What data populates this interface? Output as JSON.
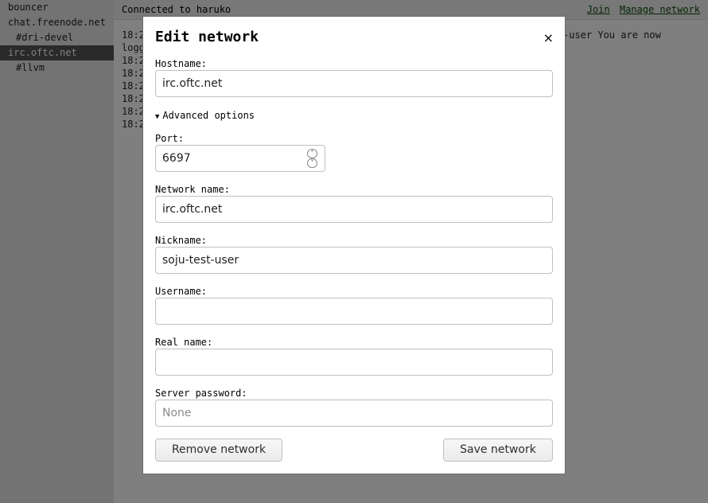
{
  "sidebar": {
    "buffers": [
      {
        "label": "bouncer",
        "type": "server",
        "active": false
      },
      {
        "label": "chat.freenode.net",
        "type": "server",
        "active": false
      },
      {
        "label": "#dri-devel",
        "type": "channel",
        "active": false
      },
      {
        "label": "irc.oftc.net",
        "type": "server",
        "active": true
      },
      {
        "label": "#llvm",
        "type": "channel",
        "active": false
      }
    ]
  },
  "topbar": {
    "status": "Connected to haruko",
    "join_label": "Join",
    "manage_label": "Manage network",
    "link_color": "#064e00"
  },
  "log": {
    "lines": [
      "18:2",
      "logg",
      "18:2",
      "18:2",
      "18:2",
      "18:2",
      "18:2",
      "18:2"
    ],
    "right_fragment": "-user You are now"
  },
  "dialog": {
    "title": "Edit network",
    "close_glyph": "×",
    "hostname": {
      "label": "Hostname:",
      "value": "irc.oftc.net"
    },
    "advanced": {
      "label": "Advanced options",
      "expanded": true,
      "glyph": "▼"
    },
    "port": {
      "label": "Port:",
      "value": "6697"
    },
    "network_name": {
      "label": "Network name:",
      "value": "irc.oftc.net"
    },
    "nickname": {
      "label": "Nickname:",
      "value": "soju-test-user"
    },
    "username": {
      "label": "Username:",
      "value": ""
    },
    "realname": {
      "label": "Real name:",
      "value": ""
    },
    "password": {
      "label": "Server password:",
      "value": "",
      "placeholder": "None"
    },
    "remove_label": "Remove network",
    "save_label": "Save network"
  }
}
